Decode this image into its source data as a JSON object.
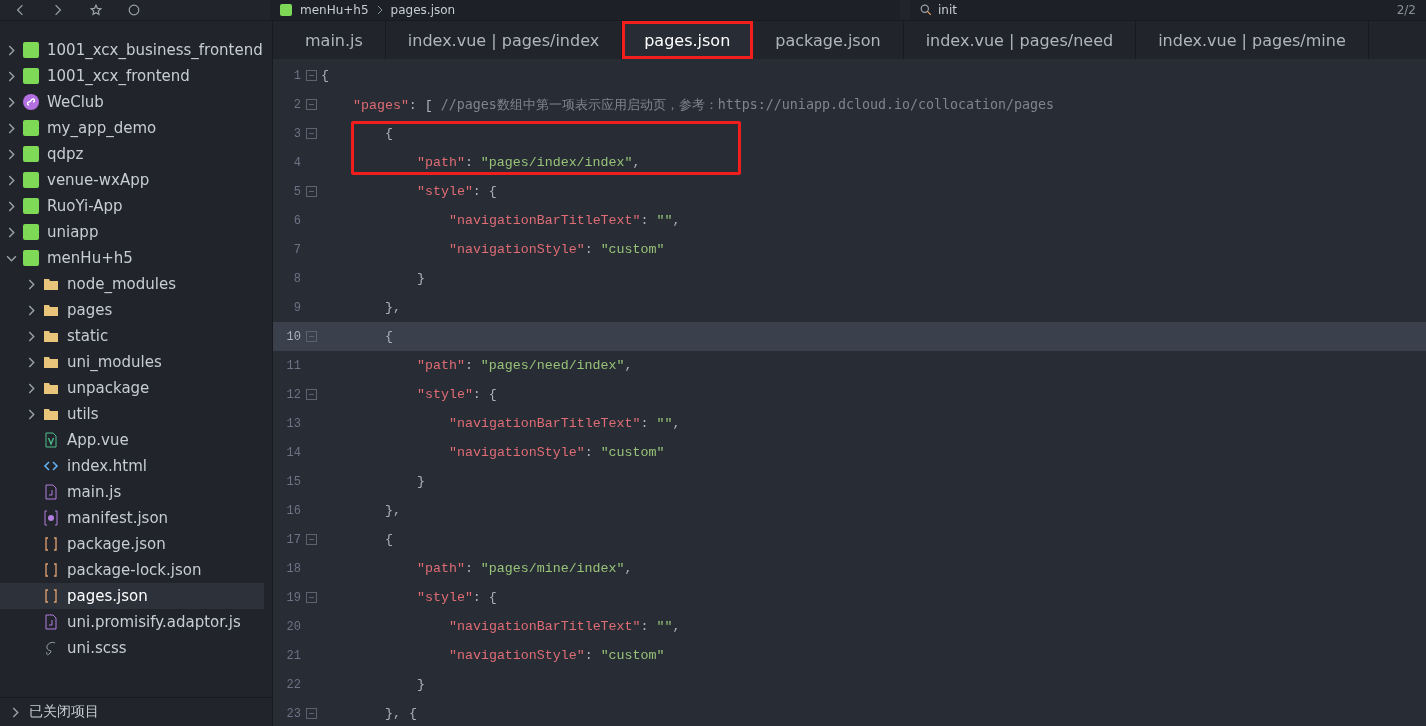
{
  "toolbar": {
    "breadcrumb": [
      "menHu+h5",
      "pages.json"
    ],
    "search": {
      "value": "init",
      "count": "2/2"
    }
  },
  "sidebar": {
    "items": [
      {
        "label": "1001_xcx_business_frontend",
        "kind": "uni",
        "expanded": false,
        "selected": false
      },
      {
        "label": "1001_xcx_frontend",
        "kind": "uni",
        "expanded": false,
        "selected": false
      },
      {
        "label": "WeClub",
        "kind": "miniapp",
        "expanded": false,
        "selected": false
      },
      {
        "label": "my_app_demo",
        "kind": "uni",
        "expanded": false,
        "selected": false
      },
      {
        "label": "qdpz",
        "kind": "uni",
        "expanded": false,
        "selected": false
      },
      {
        "label": "venue-wxApp",
        "kind": "uni",
        "expanded": false,
        "selected": false
      },
      {
        "label": "RuoYi-App",
        "kind": "uni",
        "expanded": false,
        "selected": false
      },
      {
        "label": "uniapp",
        "kind": "uni",
        "expanded": false,
        "selected": false
      },
      {
        "label": "menHu+h5",
        "kind": "uni",
        "expanded": true,
        "selected": false,
        "children": [
          {
            "label": "node_modules",
            "kind": "folder",
            "expanded": false,
            "selected": false
          },
          {
            "label": "pages",
            "kind": "folder",
            "expanded": false,
            "selected": false
          },
          {
            "label": "static",
            "kind": "folder",
            "expanded": false,
            "selected": false
          },
          {
            "label": "uni_modules",
            "kind": "folder",
            "expanded": false,
            "selected": false
          },
          {
            "label": "unpackage",
            "kind": "folder",
            "expanded": false,
            "selected": false
          },
          {
            "label": "utils",
            "kind": "folder",
            "expanded": false,
            "selected": false
          },
          {
            "label": "App.vue",
            "kind": "vue",
            "selected": false
          },
          {
            "label": "index.html",
            "kind": "html",
            "selected": false
          },
          {
            "label": "main.js",
            "kind": "js",
            "selected": false
          },
          {
            "label": "manifest.json",
            "kind": "manifest",
            "selected": false
          },
          {
            "label": "package.json",
            "kind": "json",
            "selected": false
          },
          {
            "label": "package-lock.json",
            "kind": "json",
            "selected": false
          },
          {
            "label": "pages.json",
            "kind": "json",
            "selected": true
          },
          {
            "label": "uni.promisify.adaptor.js",
            "kind": "js",
            "selected": false
          },
          {
            "label": "uni.scss",
            "kind": "scss",
            "selected": false
          }
        ]
      }
    ],
    "footer": "已关闭项目"
  },
  "tabs": [
    {
      "label": "main.js",
      "selected": false,
      "marked": false
    },
    {
      "label": "index.vue | pages/index",
      "selected": false,
      "marked": false
    },
    {
      "label": "pages.json",
      "selected": true,
      "marked": true
    },
    {
      "label": "package.json",
      "selected": false,
      "marked": false
    },
    {
      "label": "index.vue | pages/need",
      "selected": false,
      "marked": false
    },
    {
      "label": "index.vue | pages/mine",
      "selected": false,
      "marked": false
    }
  ],
  "editor": {
    "lines": [
      {
        "n": "1",
        "fold": true,
        "current": false,
        "boxed": false,
        "tokens": [
          {
            "kind": "punct",
            "text": "{"
          }
        ]
      },
      {
        "n": "2",
        "fold": true,
        "current": false,
        "boxed": false,
        "tokens": [
          {
            "kind": "key",
            "text": "\"pages\""
          },
          {
            "kind": "punct",
            "text": ": [ "
          },
          {
            "kind": "comment",
            "text": "//pages数组中第一项表示应用启动页，参考：https://uniapp.dcloud.io/collocation/pages"
          }
        ]
      },
      {
        "n": "3",
        "fold": true,
        "current": false,
        "boxed": true,
        "tokens": [
          {
            "kind": "punct",
            "text": "{"
          }
        ]
      },
      {
        "n": "4",
        "fold": false,
        "current": false,
        "boxed": true,
        "tokens": [
          {
            "kind": "key",
            "text": "\"path\""
          },
          {
            "kind": "punct",
            "text": ": "
          },
          {
            "kind": "string",
            "text": "\"pages/index/index\""
          },
          {
            "kind": "punct",
            "text": ","
          }
        ]
      },
      {
        "n": "5",
        "fold": true,
        "current": false,
        "boxed": false,
        "tokens": [
          {
            "kind": "key",
            "text": "\"style\""
          },
          {
            "kind": "punct",
            "text": ": {"
          }
        ]
      },
      {
        "n": "6",
        "fold": false,
        "current": false,
        "boxed": false,
        "tokens": [
          {
            "kind": "key",
            "text": "\"navigationBarTitleText\""
          },
          {
            "kind": "punct",
            "text": ": "
          },
          {
            "kind": "string",
            "text": "\"\""
          },
          {
            "kind": "punct",
            "text": ","
          }
        ]
      },
      {
        "n": "7",
        "fold": false,
        "current": false,
        "boxed": false,
        "tokens": [
          {
            "kind": "key",
            "text": "\"navigationStyle\""
          },
          {
            "kind": "punct",
            "text": ": "
          },
          {
            "kind": "string",
            "text": "\"custom\""
          }
        ]
      },
      {
        "n": "8",
        "fold": false,
        "current": false,
        "boxed": false,
        "tokens": [
          {
            "kind": "punct",
            "text": "}"
          }
        ]
      },
      {
        "n": "9",
        "fold": false,
        "current": false,
        "boxed": false,
        "tokens": [
          {
            "kind": "punct",
            "text": "},"
          }
        ]
      },
      {
        "n": "10",
        "fold": true,
        "current": true,
        "boxed": false,
        "tokens": [
          {
            "kind": "punct",
            "text": "{"
          }
        ]
      },
      {
        "n": "11",
        "fold": false,
        "current": false,
        "boxed": false,
        "tokens": [
          {
            "kind": "key",
            "text": "\"path\""
          },
          {
            "kind": "punct",
            "text": ": "
          },
          {
            "kind": "string",
            "text": "\"pages/need/index\""
          },
          {
            "kind": "punct",
            "text": ","
          }
        ]
      },
      {
        "n": "12",
        "fold": true,
        "current": false,
        "boxed": false,
        "tokens": [
          {
            "kind": "key",
            "text": "\"style\""
          },
          {
            "kind": "punct",
            "text": ": {"
          }
        ]
      },
      {
        "n": "13",
        "fold": false,
        "current": false,
        "boxed": false,
        "tokens": [
          {
            "kind": "key",
            "text": "\"navigationBarTitleText\""
          },
          {
            "kind": "punct",
            "text": ": "
          },
          {
            "kind": "string",
            "text": "\"\""
          },
          {
            "kind": "punct",
            "text": ","
          }
        ]
      },
      {
        "n": "14",
        "fold": false,
        "current": false,
        "boxed": false,
        "tokens": [
          {
            "kind": "key",
            "text": "\"navigationStyle\""
          },
          {
            "kind": "punct",
            "text": ": "
          },
          {
            "kind": "string",
            "text": "\"custom\""
          }
        ]
      },
      {
        "n": "15",
        "fold": false,
        "current": false,
        "boxed": false,
        "tokens": [
          {
            "kind": "punct",
            "text": "}"
          }
        ]
      },
      {
        "n": "16",
        "fold": false,
        "current": false,
        "boxed": false,
        "tokens": [
          {
            "kind": "punct",
            "text": "},"
          }
        ]
      },
      {
        "n": "17",
        "fold": true,
        "current": false,
        "boxed": false,
        "tokens": [
          {
            "kind": "punct",
            "text": "{"
          }
        ]
      },
      {
        "n": "18",
        "fold": false,
        "current": false,
        "boxed": false,
        "tokens": [
          {
            "kind": "key",
            "text": "\"path\""
          },
          {
            "kind": "punct",
            "text": ": "
          },
          {
            "kind": "string",
            "text": "\"pages/mine/index\""
          },
          {
            "kind": "punct",
            "text": ","
          }
        ]
      },
      {
        "n": "19",
        "fold": true,
        "current": false,
        "boxed": false,
        "tokens": [
          {
            "kind": "key",
            "text": "\"style\""
          },
          {
            "kind": "punct",
            "text": ": {"
          }
        ]
      },
      {
        "n": "20",
        "fold": false,
        "current": false,
        "boxed": false,
        "tokens": [
          {
            "kind": "key",
            "text": "\"navigationBarTitleText\""
          },
          {
            "kind": "punct",
            "text": ": "
          },
          {
            "kind": "string",
            "text": "\"\""
          },
          {
            "kind": "punct",
            "text": ","
          }
        ]
      },
      {
        "n": "21",
        "fold": false,
        "current": false,
        "boxed": false,
        "tokens": [
          {
            "kind": "key",
            "text": "\"navigationStyle\""
          },
          {
            "kind": "punct",
            "text": ": "
          },
          {
            "kind": "string",
            "text": "\"custom\""
          }
        ]
      },
      {
        "n": "22",
        "fold": false,
        "current": false,
        "boxed": false,
        "tokens": [
          {
            "kind": "punct",
            "text": "}"
          }
        ]
      },
      {
        "n": "23",
        "fold": true,
        "current": false,
        "boxed": false,
        "tokens": [
          {
            "kind": "punct",
            "text": "}, {"
          }
        ]
      }
    ]
  }
}
